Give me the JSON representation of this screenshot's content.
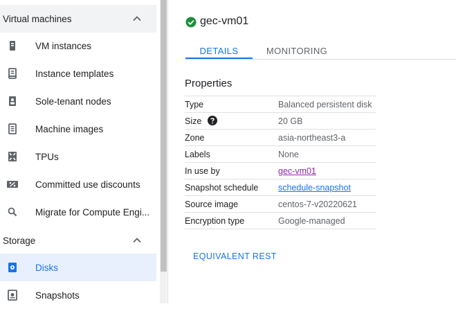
{
  "sidebar": {
    "sections": [
      {
        "title": "Virtual machines",
        "items": [
          {
            "label": "VM instances",
            "icon": "vm-instance-icon"
          },
          {
            "label": "Instance templates",
            "icon": "instance-template-icon"
          },
          {
            "label": "Sole-tenant nodes",
            "icon": "sole-tenant-icon"
          },
          {
            "label": "Machine images",
            "icon": "machine-image-icon"
          },
          {
            "label": "TPUs",
            "icon": "tpu-icon"
          },
          {
            "label": "Committed use discounts",
            "icon": "percent-icon"
          },
          {
            "label": "Migrate for Compute Engi...",
            "icon": "search-icon"
          }
        ]
      },
      {
        "title": "Storage",
        "items": [
          {
            "label": "Disks",
            "icon": "disk-icon",
            "active": true
          },
          {
            "label": "Snapshots",
            "icon": "snapshot-icon"
          }
        ]
      }
    ]
  },
  "main": {
    "title": "gec-vm01",
    "status": "running",
    "tabs": [
      {
        "label": "DETAILS",
        "active": true
      },
      {
        "label": "MONITORING",
        "active": false
      }
    ],
    "properties_title": "Properties",
    "properties": [
      {
        "key": "Type",
        "value": "Balanced persistent disk"
      },
      {
        "key": "Size",
        "value": "20 GB"
      },
      {
        "key": "Zone",
        "value": "asia-northeast3-a"
      },
      {
        "key": "Labels",
        "value": "None"
      },
      {
        "key": "In use by",
        "value": "gec-vm01"
      },
      {
        "key": "Snapshot schedule",
        "value": "schedule-snapshot"
      },
      {
        "key": "Source image",
        "value": "centos-7-v20220621"
      },
      {
        "key": "Encryption type",
        "value": "Google-managed"
      }
    ],
    "equivalent_rest": "EQUIVALENT REST"
  },
  "colors": {
    "accent": "#1a73e8",
    "success": "#1e8e3e",
    "visited_link": "#8e24aa",
    "active_bg": "#e8f0fe",
    "section_bg": "#f1f3f4"
  }
}
